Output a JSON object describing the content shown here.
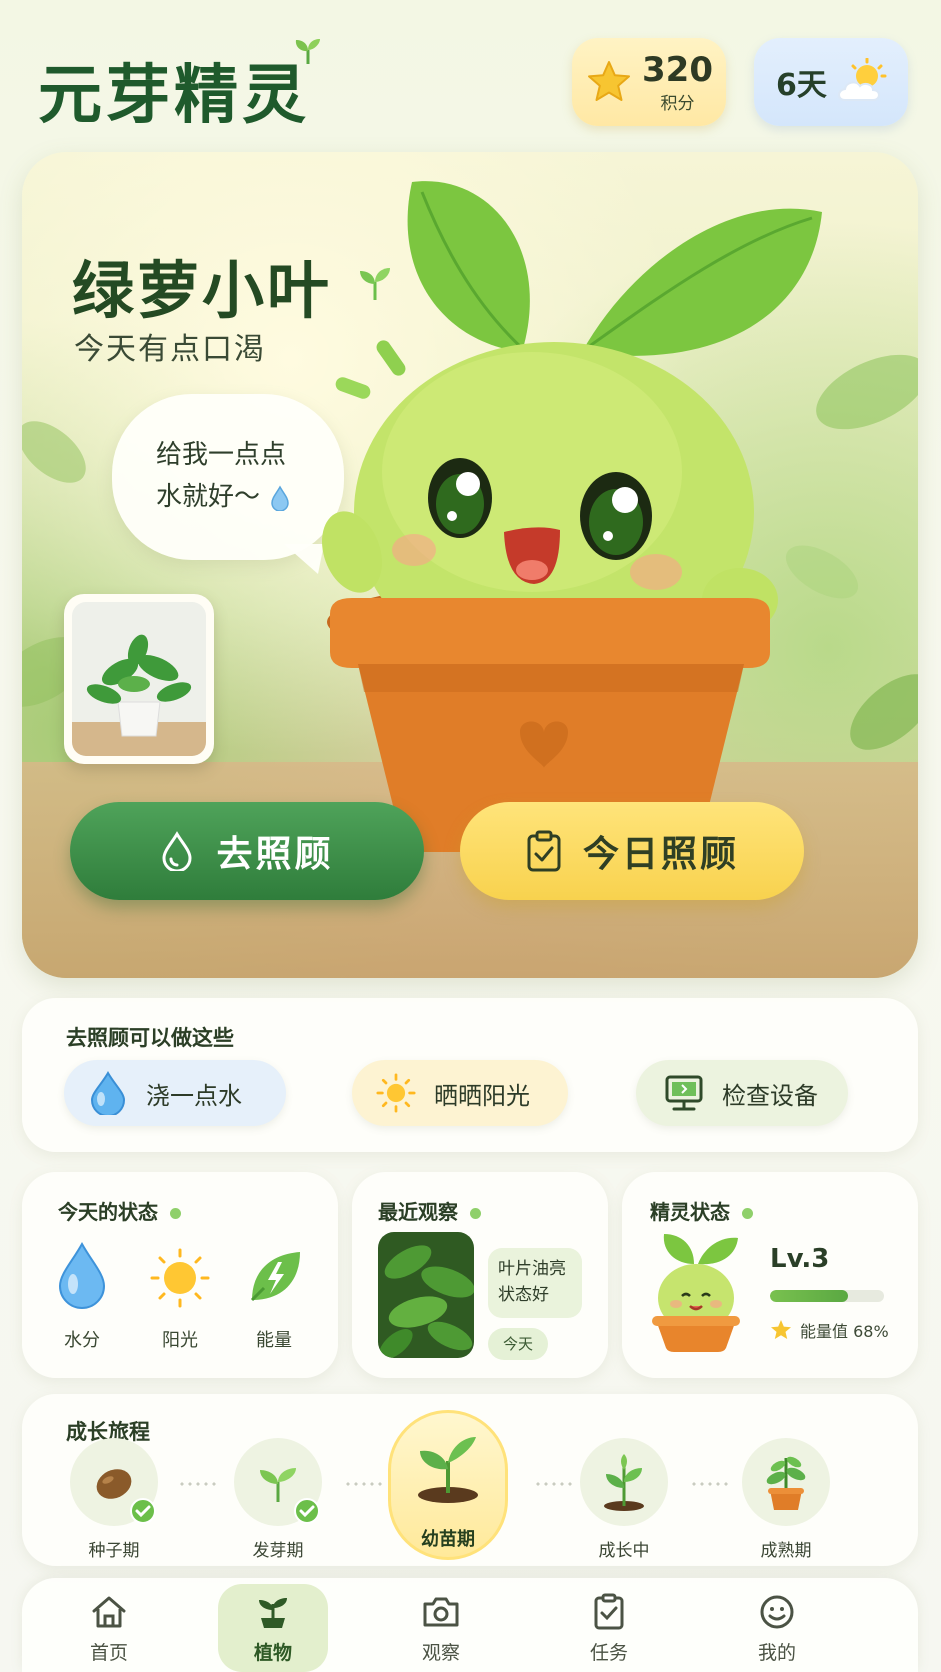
{
  "header": {
    "app_title": "元芽精灵",
    "points": {
      "value": "320",
      "label": "积分"
    },
    "days": "6天"
  },
  "hero": {
    "plant_name": "绿萝小叶",
    "status": "今天有点口渴",
    "speech": [
      "给我一点点",
      "水就好～"
    ],
    "care_button": "去照顾",
    "today_button": "今日照顾"
  },
  "actions": {
    "title": "去照顾可以做这些",
    "items": [
      {
        "label": "浇一点水",
        "icon": "water-drop-icon"
      },
      {
        "label": "晒晒阳光",
        "icon": "sun-icon"
      },
      {
        "label": "检查设备",
        "icon": "device-monitor-icon"
      }
    ]
  },
  "today_status": {
    "title": "今天的状态",
    "items": [
      {
        "label": "水分",
        "icon": "water-drop-icon"
      },
      {
        "label": "阳光",
        "icon": "sun-icon"
      },
      {
        "label": "能量",
        "icon": "energy-leaf-icon"
      }
    ]
  },
  "recent_observation": {
    "title": "最近观察",
    "note": [
      "叶片油亮",
      "状态好"
    ],
    "tag": "今天"
  },
  "spirit_status": {
    "title": "精灵状态",
    "level": "Lv.3",
    "energy_label": "能量值 68%",
    "energy_fraction": 0.68
  },
  "growth": {
    "title": "成长旅程",
    "stages": [
      {
        "label": "种子期",
        "done": true
      },
      {
        "label": "发芽期",
        "done": true
      },
      {
        "label": "幼苗期",
        "current": true
      },
      {
        "label": "成长中"
      },
      {
        "label": "成熟期"
      }
    ]
  },
  "nav": {
    "items": [
      {
        "label": "首页",
        "icon": "home-icon"
      },
      {
        "label": "植物",
        "icon": "plant-icon",
        "active": true
      },
      {
        "label": "观察",
        "icon": "camera-icon"
      },
      {
        "label": "任务",
        "icon": "task-clipboard-icon"
      },
      {
        "label": "我的",
        "icon": "smiley-profile-icon"
      }
    ]
  },
  "colors": {
    "brand_green": "#1f5a2c",
    "care_button": "#2f7d3b",
    "today_button": "#f8d24e",
    "progress": "#5aa842"
  }
}
